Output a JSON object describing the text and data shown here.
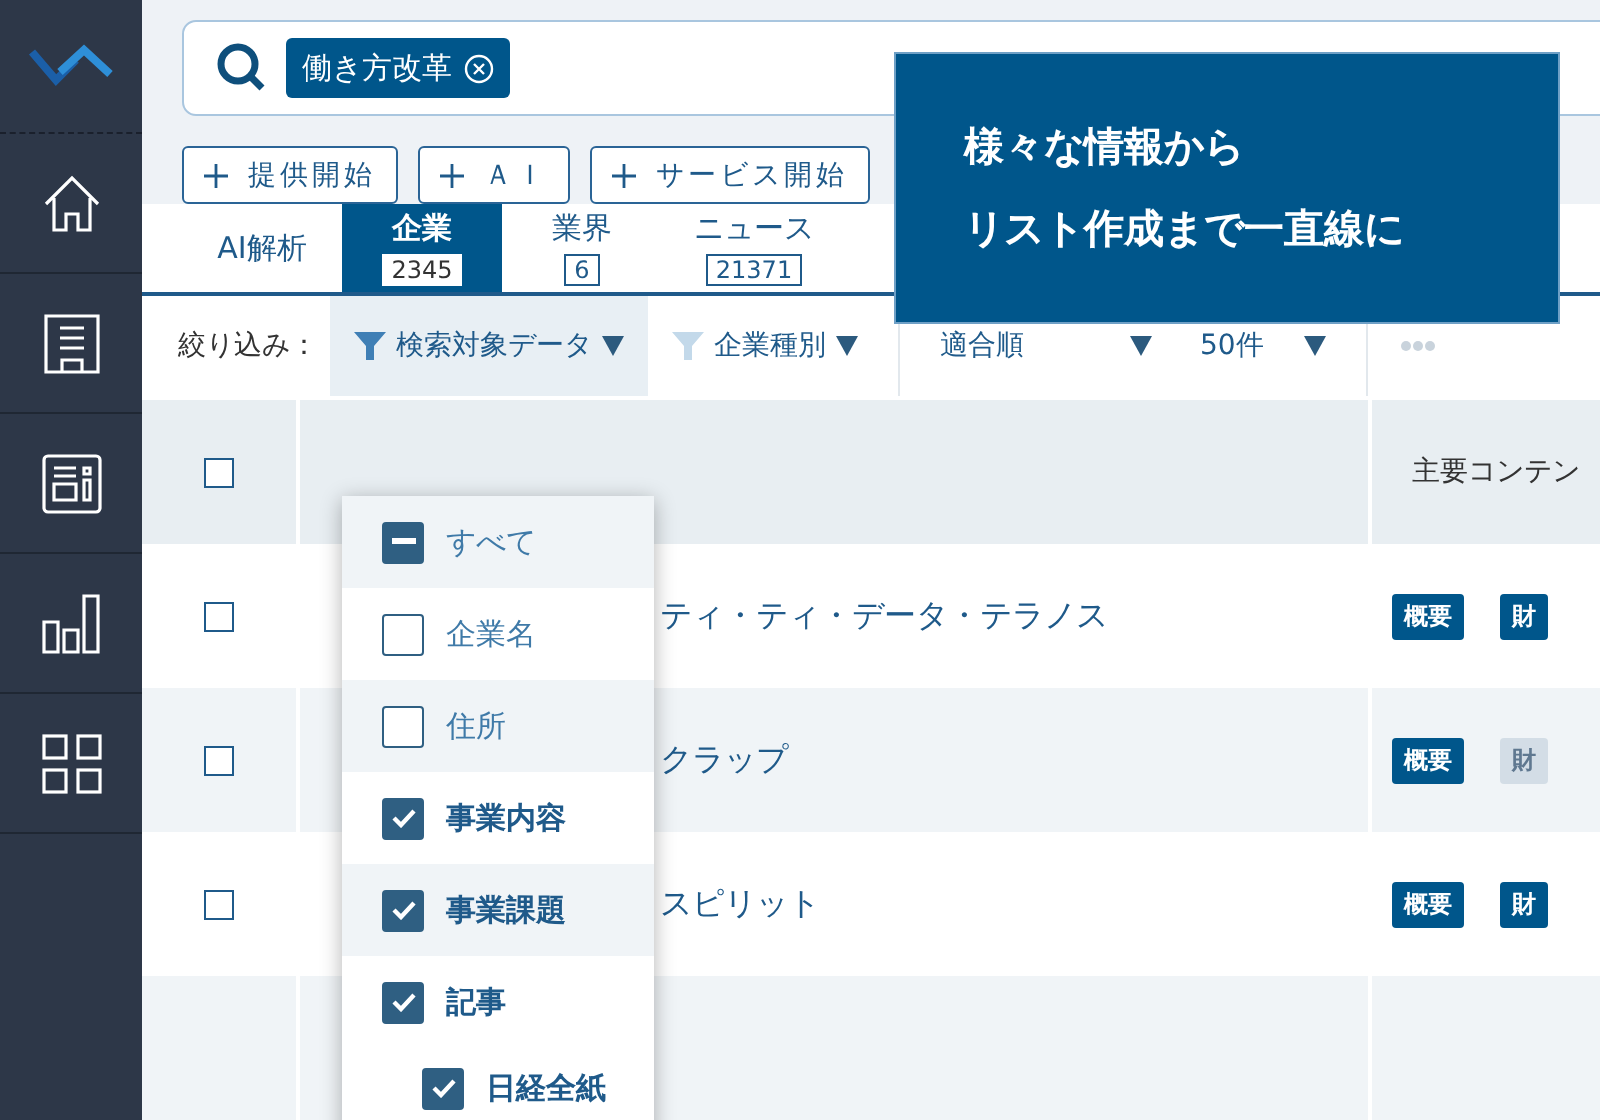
{
  "search": {
    "chips": [
      {
        "label": "働き方改革"
      }
    ]
  },
  "quick_tags": [
    "提供開始",
    "ＡＩ",
    "サービス開始"
  ],
  "tabs": [
    {
      "label": "AI解析",
      "selected": false
    },
    {
      "label": "企業",
      "count": "2345",
      "selected": true
    },
    {
      "label": "業界",
      "count": "6",
      "selected": false
    },
    {
      "label": "ニュース",
      "count": "21371",
      "selected": false
    }
  ],
  "filter_bar": {
    "label": "絞り込み：",
    "filters": [
      {
        "label": "検索対象データ",
        "active": true
      },
      {
        "label": "企業種別",
        "active": false
      }
    ],
    "sort": "適合順",
    "per_page": "50件"
  },
  "filter_menu": {
    "options": [
      {
        "label": "すべて",
        "checked": false,
        "indeterminate": true
      },
      {
        "label": "企業名",
        "checked": false
      },
      {
        "label": "住所",
        "checked": false
      },
      {
        "label": "事業内容",
        "checked": true
      },
      {
        "label": "事業課題",
        "checked": true
      },
      {
        "label": "記事",
        "checked": true,
        "children": [
          {
            "label": "日経全紙",
            "checked": true
          }
        ]
      }
    ]
  },
  "table": {
    "columns": [
      "主要コンテン"
    ],
    "all_checked": false,
    "rows": [
      {
        "checked": false,
        "name": "ティ・ティ・データ・テラノス",
        "badges": [
          {
            "label": "概要",
            "available": true
          },
          {
            "label": "財",
            "available": true
          }
        ]
      },
      {
        "checked": false,
        "name": "クラップ",
        "badges": [
          {
            "label": "概要",
            "available": true
          },
          {
            "label": "財",
            "available": false
          }
        ]
      },
      {
        "checked": false,
        "name": "スピリット",
        "badges": [
          {
            "label": "概要",
            "available": true
          },
          {
            "label": "財",
            "available": true
          }
        ]
      }
    ]
  },
  "callout": {
    "lines": [
      "様々な情報から",
      "リスト作成まで一直線に"
    ]
  }
}
